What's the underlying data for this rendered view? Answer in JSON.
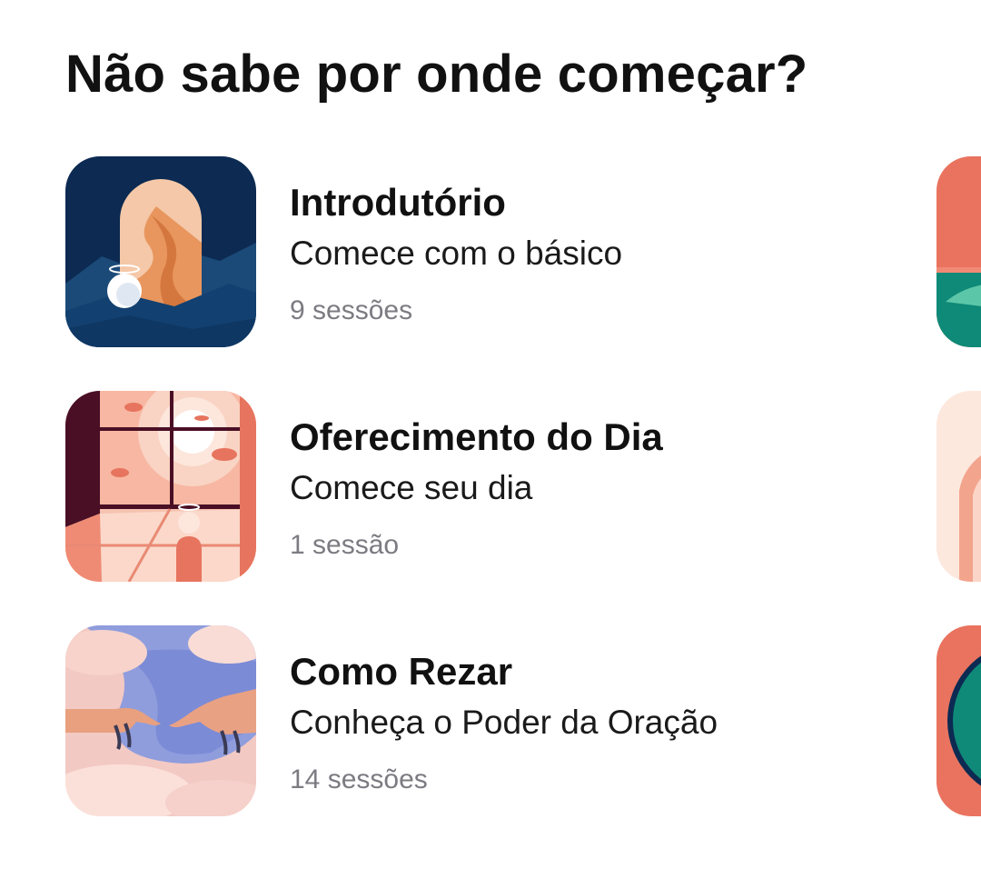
{
  "section": {
    "title": "Não sabe por onde começar?"
  },
  "items": [
    {
      "title": "Introdutório",
      "subtitle": "Comece com o básico",
      "meta": "9 sessões",
      "thumb_icon": "desert-arch-icon",
      "accent": "#0d2d55"
    },
    {
      "title": "Oferecimento do Dia",
      "subtitle": "Comece seu dia",
      "meta": "1 sessão",
      "thumb_icon": "sunlit-window-icon",
      "accent": "#f2b6a4"
    },
    {
      "title": "Como Rezar",
      "subtitle": "Conheça o Poder da Oração",
      "meta": "14 sessões",
      "thumb_icon": "reaching-hands-icon",
      "accent": "#8fa0dd"
    }
  ],
  "peek_items": [
    {
      "thumb_icon": "coral-teal-landscape-icon",
      "accent": "#e9735f"
    },
    {
      "thumb_icon": "peach-arch-icon",
      "accent": "#f6d4c6"
    },
    {
      "thumb_icon": "teal-circle-icon",
      "accent": "#e9735f"
    }
  ]
}
